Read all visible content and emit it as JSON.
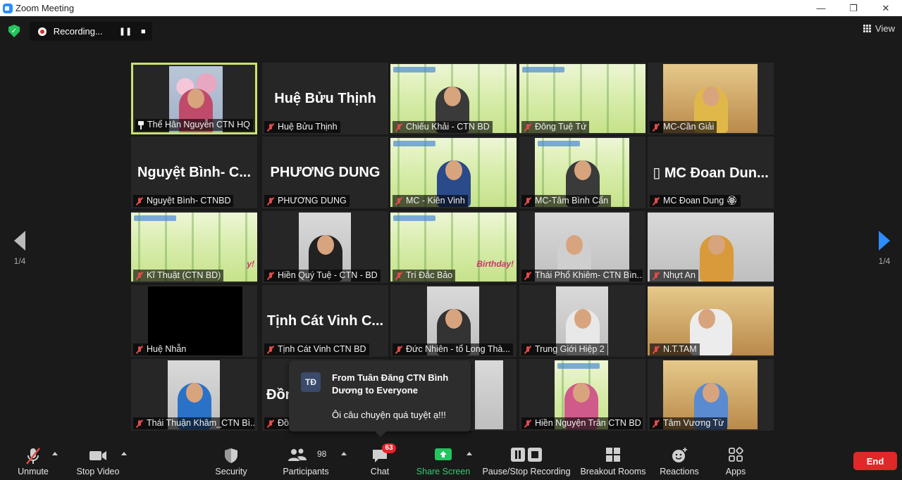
{
  "window": {
    "title": "Zoom Meeting",
    "controls": [
      "—",
      "❐",
      "✕"
    ]
  },
  "recording": {
    "label": "Recording...",
    "pause": "❚❚",
    "stop": "■"
  },
  "view": {
    "label": "View"
  },
  "nav": {
    "left_page": "1/4",
    "right_page": "1/4"
  },
  "tiles": [
    {
      "name": "Thể Hân Nguyễn CTN HQ",
      "display": "",
      "pinned": true
    },
    {
      "name": "Huệ Bửu Thịnh",
      "display": "Huệ Bửu Thịnh"
    },
    {
      "name": "Chiếu Khải - CTN BD",
      "display": ""
    },
    {
      "name": "Đông Tuệ Tứ",
      "display": ""
    },
    {
      "name": "MC-Cần Giải",
      "display": ""
    },
    {
      "name": "Nguyệt Bình- CTNBD",
      "display": "Nguyệt Bình- C..."
    },
    {
      "name": "PHƯƠNG DUNG",
      "display": "PHƯƠNG DUNG"
    },
    {
      "name": "MC - Kiên Vinh",
      "display": ""
    },
    {
      "name": "MC-Tâm Bình Cẩn",
      "display": ""
    },
    {
      "name": "MC Đoan Dung 🏵",
      "display": "▯ MC Đoan Dun..."
    },
    {
      "name": "Kĩ Thuật (CTN BD)",
      "display": "",
      "overlay": "y!"
    },
    {
      "name": "Hiền Quý Tuệ - CTN - BD",
      "display": ""
    },
    {
      "name": "Trí Đắc Bảo",
      "display": "",
      "overlay": "Birthday!"
    },
    {
      "name": "Thái Phổ Khiêm- CTN Bìn...",
      "display": ""
    },
    {
      "name": "Nhựt An",
      "display": ""
    },
    {
      "name": "Huệ Nhẫn",
      "display": ""
    },
    {
      "name": "Tịnh Cát Vinh CTN BD",
      "display": "Tịnh Cát Vinh C..."
    },
    {
      "name": "Đức Nhiên - tổ Long Thà...",
      "display": ""
    },
    {
      "name": "Trung Giới Hiệp 2",
      "display": ""
    },
    {
      "name": "N.T.TAM",
      "display": ""
    },
    {
      "name": "Thái Thuận Khâm_CTN Bì...",
      "display": ""
    },
    {
      "name": "Đồ",
      "display": "Đồn"
    },
    {
      "name": "",
      "display": ""
    },
    {
      "name": "Hiền Nguyện Trân CTN BD",
      "display": ""
    },
    {
      "name": "Tâm Vương Từ",
      "display": ""
    }
  ],
  "chat_popup": {
    "avatar": "TĐ",
    "from": "From Tuân Đăng CTN Bình Dương to Everyone",
    "message": "Ôi câu chuyện quá tuyệt ạ!!!"
  },
  "toolbar": {
    "unmute": "Unmute",
    "stop_video": "Stop Video",
    "security": "Security",
    "participants": "Participants",
    "participants_count": "98",
    "chat": "Chat",
    "chat_badge": "63",
    "share_screen": "Share Screen",
    "pause_stop_recording": "Pause/Stop Recording",
    "breakout_rooms": "Breakout Rooms",
    "reactions": "Reactions",
    "apps": "Apps",
    "end": "End"
  },
  "colors": {
    "accent": "#2d8cff",
    "active_border": "#c9e36b",
    "share_green": "#23c55e",
    "end_red": "#e02828",
    "muted_red": "#e34a4a"
  }
}
